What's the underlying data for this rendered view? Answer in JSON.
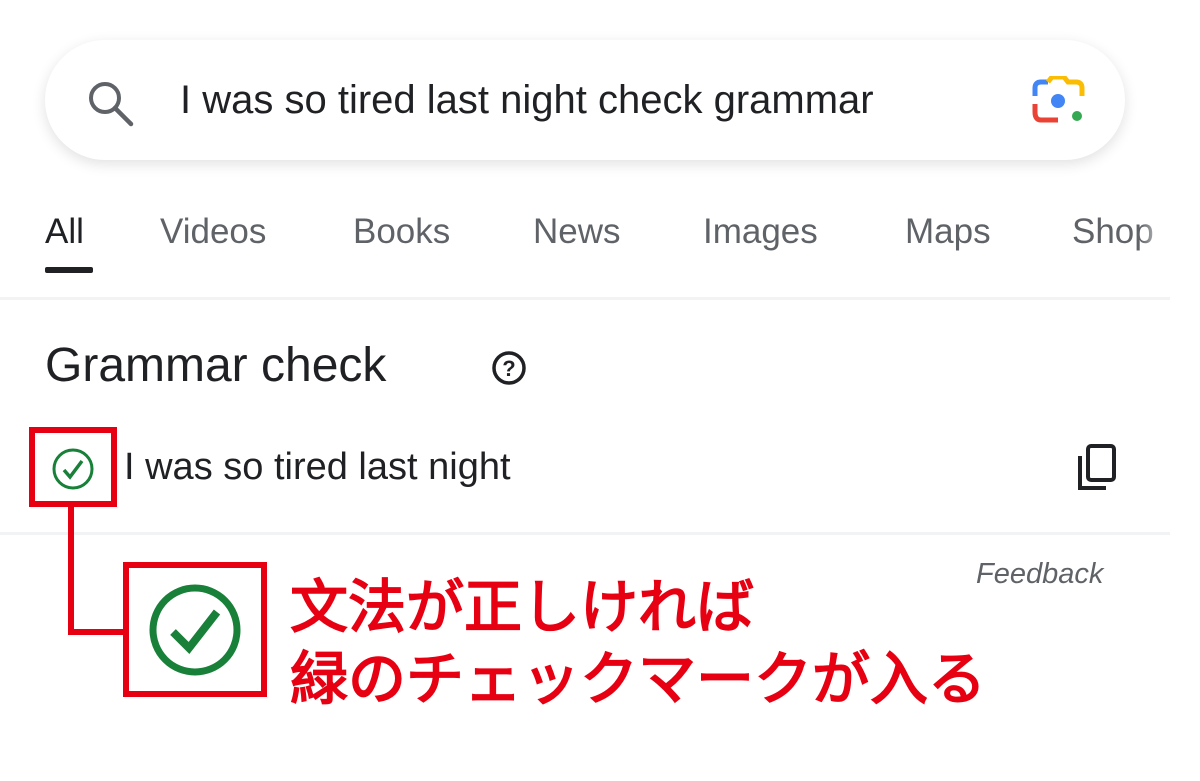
{
  "search": {
    "query": "I was so tired last night check grammar",
    "search_icon": "search-icon",
    "lens_icon": "google-lens-icon"
  },
  "tabs": [
    {
      "label": "All",
      "active": true
    },
    {
      "label": "Videos"
    },
    {
      "label": "Books"
    },
    {
      "label": "News"
    },
    {
      "label": "Images"
    },
    {
      "label": "Maps"
    },
    {
      "label": "Shop"
    }
  ],
  "grammar": {
    "title": "Grammar check",
    "help_icon": "help-icon",
    "sentence": "I was so tired last night",
    "status_icon": "check-circle-icon",
    "copy_icon": "copy-icon",
    "feedback": "Feedback"
  },
  "annotation": {
    "line1": "文法が正しければ",
    "line2": "緑のチェックマークが入る",
    "color": "#e60012",
    "check_color": "#188038"
  }
}
